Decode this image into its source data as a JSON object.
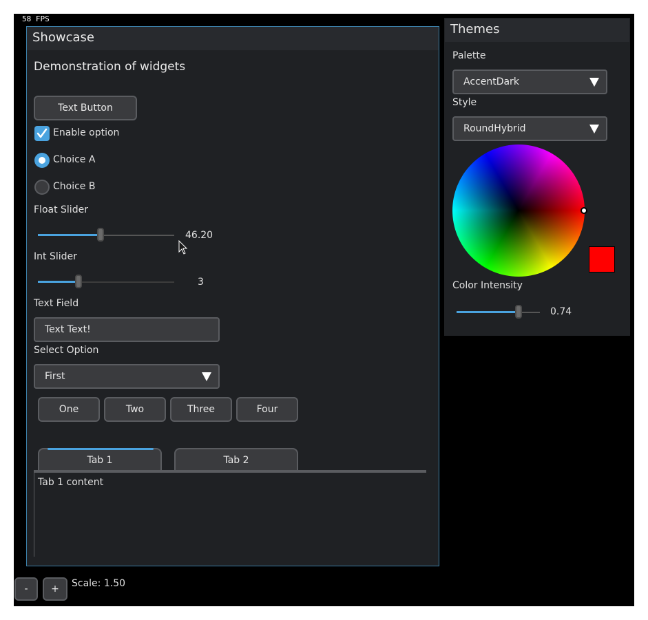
{
  "fps": "58 FPS",
  "showcase": {
    "title": "Showcase",
    "heading": "Demonstration of widgets",
    "text_button": "Text Button",
    "checkbox": {
      "label": "Enable option",
      "checked": true
    },
    "radio": [
      {
        "label": "Choice A",
        "selected": true
      },
      {
        "label": "Choice B",
        "selected": false
      }
    ],
    "float_slider": {
      "label": "Float Slider",
      "value_text": "46.20",
      "fraction": 0.46
    },
    "int_slider": {
      "label": "Int Slider",
      "value_text": "3",
      "fraction": 0.3
    },
    "text_field": {
      "label": "Text Field",
      "value": "Text Text!"
    },
    "select": {
      "label": "Select Option",
      "value": "First"
    },
    "button_row": [
      "One",
      "Two",
      "Three",
      "Four"
    ],
    "tabs": [
      {
        "label": "Tab 1",
        "active": true
      },
      {
        "label": "Tab 2",
        "active": false
      }
    ],
    "tab_content": "Tab 1 content"
  },
  "themes": {
    "title": "Themes",
    "palette": {
      "label": "Palette",
      "value": "AccentDark"
    },
    "style": {
      "label": "Style",
      "value": "RoundHybrid"
    },
    "selected_color": "#ff0000",
    "color_intensity": {
      "label": "Color Intensity",
      "value_text": "0.74",
      "fraction": 0.74
    }
  },
  "scale": {
    "minus": "-",
    "plus": "+",
    "text": "Scale: 1.50"
  },
  "colors": {
    "accent": "#4aa3df",
    "panel": "#1f2124",
    "widget": "#3a3b3e"
  }
}
